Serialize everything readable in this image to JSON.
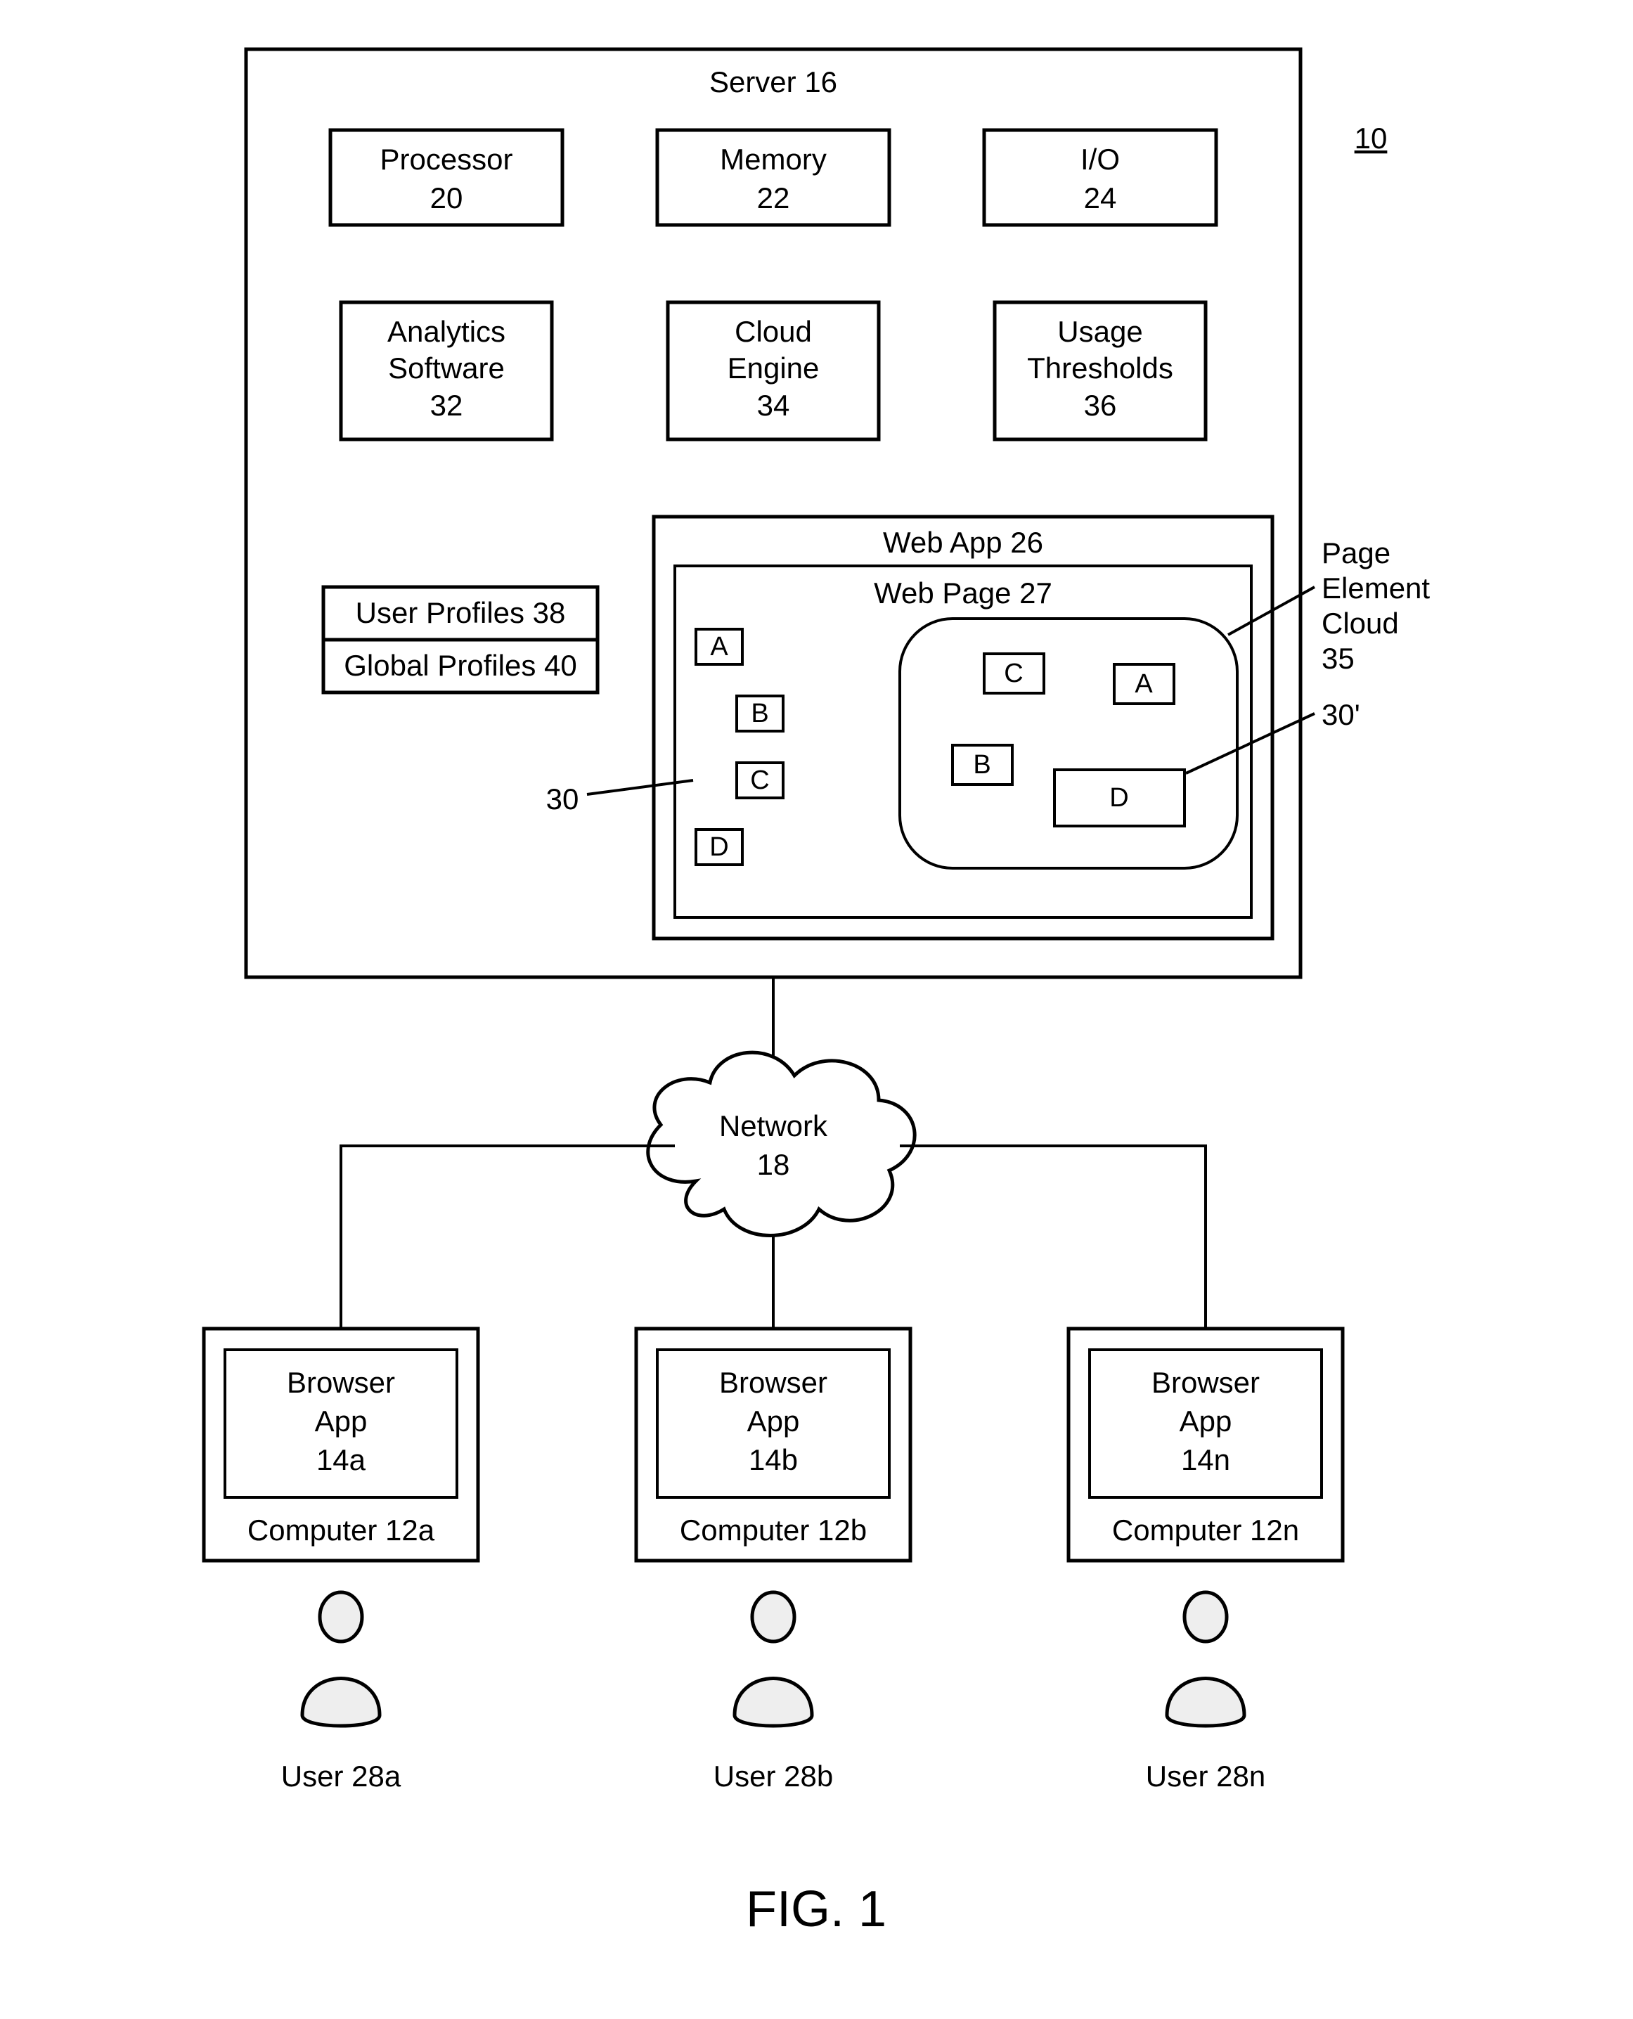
{
  "figure_label": "FIG. 1",
  "ref_10": "10",
  "server": {
    "title": "Server  16"
  },
  "processor": {
    "l1": "Processor",
    "l2": "20"
  },
  "memory": {
    "l1": "Memory",
    "l2": "22"
  },
  "io": {
    "l1": "I/O",
    "l2": "24"
  },
  "analytics": {
    "l1": "Analytics",
    "l2": "Software",
    "l3": "32"
  },
  "cloudeng": {
    "l1": "Cloud",
    "l2": "Engine",
    "l3": "34"
  },
  "usage": {
    "l1": "Usage",
    "l2": "Thresholds",
    "l3": "36"
  },
  "userprof": "User Profiles  38",
  "globprof": "Global Profiles  40",
  "webapp": "Web App  26",
  "webpage": "Web Page  27",
  "el_A": "A",
  "el_B": "B",
  "el_C": "C",
  "el_D": "D",
  "ref_30": "30",
  "ref_30p": "30'",
  "pe_l1": "Page",
  "pe_l2": "Element",
  "pe_l3": "Cloud",
  "pe_l4": "35",
  "network": {
    "l1": "Network",
    "l2": "18"
  },
  "client_a": {
    "b1": "Browser",
    "b2": "App",
    "b3": "14a",
    "c": "Computer   12a",
    "u": "User 28a"
  },
  "client_b": {
    "b1": "Browser",
    "b2": "App",
    "b3": "14b",
    "c": "Computer   12b",
    "u": "User 28b"
  },
  "client_n": {
    "b1": "Browser",
    "b2": "App",
    "b3": "14n",
    "c": "Computer   12n",
    "u": "User 28n"
  }
}
